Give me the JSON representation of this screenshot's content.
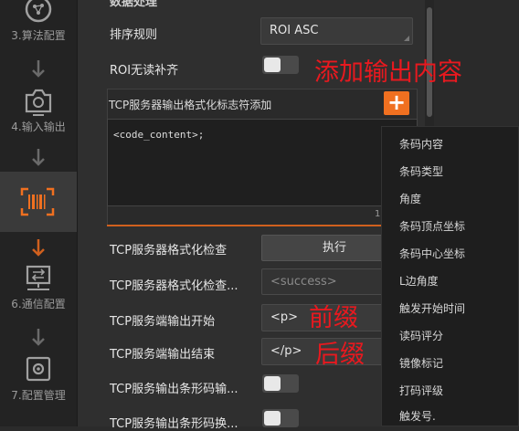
{
  "sidebar": {
    "items": [
      {
        "label": "3.算法配置",
        "icon": "algorithm-icon"
      },
      {
        "label": "4.输入输出",
        "icon": "camera-io-icon"
      },
      {
        "label": "",
        "icon": "barcode-icon"
      },
      {
        "label": "6.通信配置",
        "icon": "network-icon"
      },
      {
        "label": "7.配置管理",
        "icon": "gear-icon"
      }
    ]
  },
  "main": {
    "section_title": "数据处理",
    "sort_rule": {
      "label": "排序规则",
      "value": "ROI ASC"
    },
    "roi_no_fill": {
      "label": "ROI无读补齐"
    },
    "tcp_format_add": {
      "label": "TCP服务器输出格式化标志符添加",
      "add": "+"
    },
    "format_text": "<code_content>;",
    "partial_digit": "1",
    "tcp_check": {
      "label": "TCP服务器格式化检查",
      "button": "执行"
    },
    "tcp_check_result": {
      "label": "TCP服务器格式化检查...",
      "placeholder": "<success>"
    },
    "tcp_output_start": {
      "label": "TCP服务端输出开始",
      "value": "<p>"
    },
    "tcp_output_end": {
      "label": "TCP服务端输出结束",
      "value": "</p>"
    },
    "tcp_barcode_output": {
      "label": "TCP服务输出条形码输..."
    },
    "tcp_barcode_switch": {
      "label": "TCP服务输出条形码换..."
    }
  },
  "dropdown": {
    "items": [
      "条码内容",
      "条码类型",
      "角度",
      "条码顶点坐标",
      "条码中心坐标",
      "L边角度",
      "触发开始时间",
      "读码评分",
      "镜像标记",
      "打码评级",
      "触发号."
    ]
  },
  "annotations": {
    "add_output": "添加输出内容",
    "prefix": "前缀",
    "suffix": "后缀"
  },
  "colors": {
    "accent": "#f07020",
    "annotation": "#e8191f"
  }
}
